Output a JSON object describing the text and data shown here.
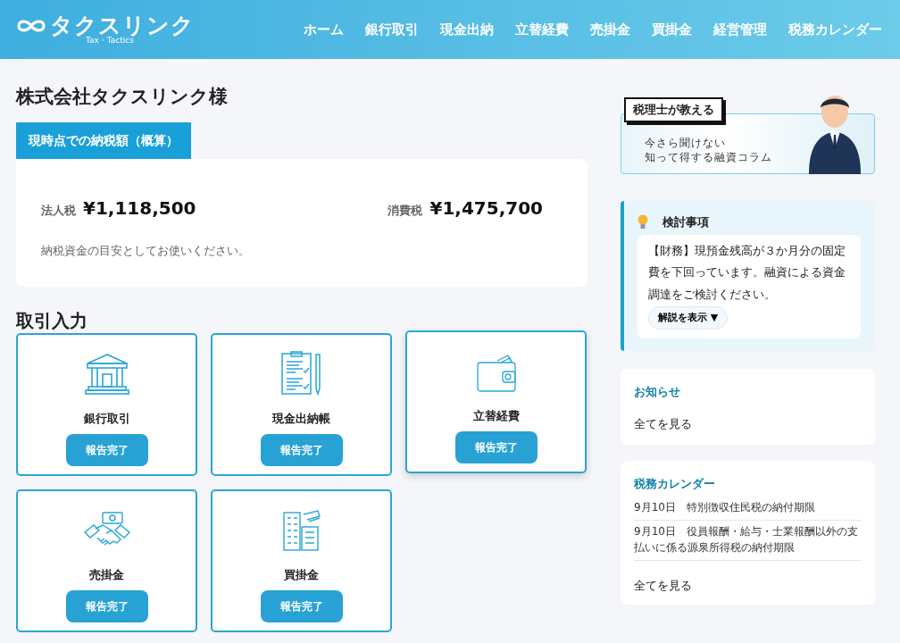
{
  "header": {
    "logo_text": "タクスリンク",
    "logo_subtext": "Tax・Tactics",
    "nav": [
      {
        "label": "ホーム"
      },
      {
        "label": "銀行取引"
      },
      {
        "label": "現金出納"
      },
      {
        "label": "立替経費"
      },
      {
        "label": "売掛金"
      },
      {
        "label": "買掛金"
      },
      {
        "label": "経営管理"
      },
      {
        "label": "税務カレンダー"
      }
    ]
  },
  "page_title": "株式会社タクスリンク様",
  "tax_summary": {
    "tab": "現時点での納税額（概算）",
    "items": [
      {
        "label": "法人税",
        "amount": "¥1,118,500"
      },
      {
        "label": "消費税",
        "amount": "¥1,475,700"
      }
    ],
    "note": "納税資金の目安としてお使いください。"
  },
  "entry": {
    "heading": "取引入力",
    "cards": [
      {
        "kind": "bank",
        "label": "銀行取引",
        "button": "報告完了",
        "highlighted": false
      },
      {
        "kind": "clipboard",
        "label": "現金出納帳",
        "button": "報告完了",
        "highlighted": false
      },
      {
        "kind": "wallet",
        "label": "立替経費",
        "button": "報告完了",
        "highlighted": true
      },
      {
        "kind": "handshake",
        "label": "売掛金",
        "button": "報告完了",
        "highlighted": false
      },
      {
        "kind": "building",
        "label": "買掛金",
        "button": "報告完了",
        "highlighted": false
      }
    ]
  },
  "sidebar": {
    "banner": {
      "badge": "税理士が教える",
      "lines": [
        "今さら聞けない",
        "知って得する融資コラム"
      ]
    },
    "consideration": {
      "title": "検討事項",
      "message": "【財務】現預金残高が３か月分の固定費を下回っています。融資による資金調達をご検討ください。",
      "toggle": "解説を表示 ▼"
    },
    "news": {
      "title": "お知らせ",
      "link": "全てを見る"
    },
    "calendar": {
      "title": "税務カレンダー",
      "events": [
        {
          "date": "9月10日",
          "text": "特別徴収住民税の納付期限"
        },
        {
          "date": "9月10日",
          "text": "役員報酬・給与・士業報酬以外の支払いに係る源泉所得税の納付期限"
        }
      ],
      "link": "全てを見る"
    }
  }
}
